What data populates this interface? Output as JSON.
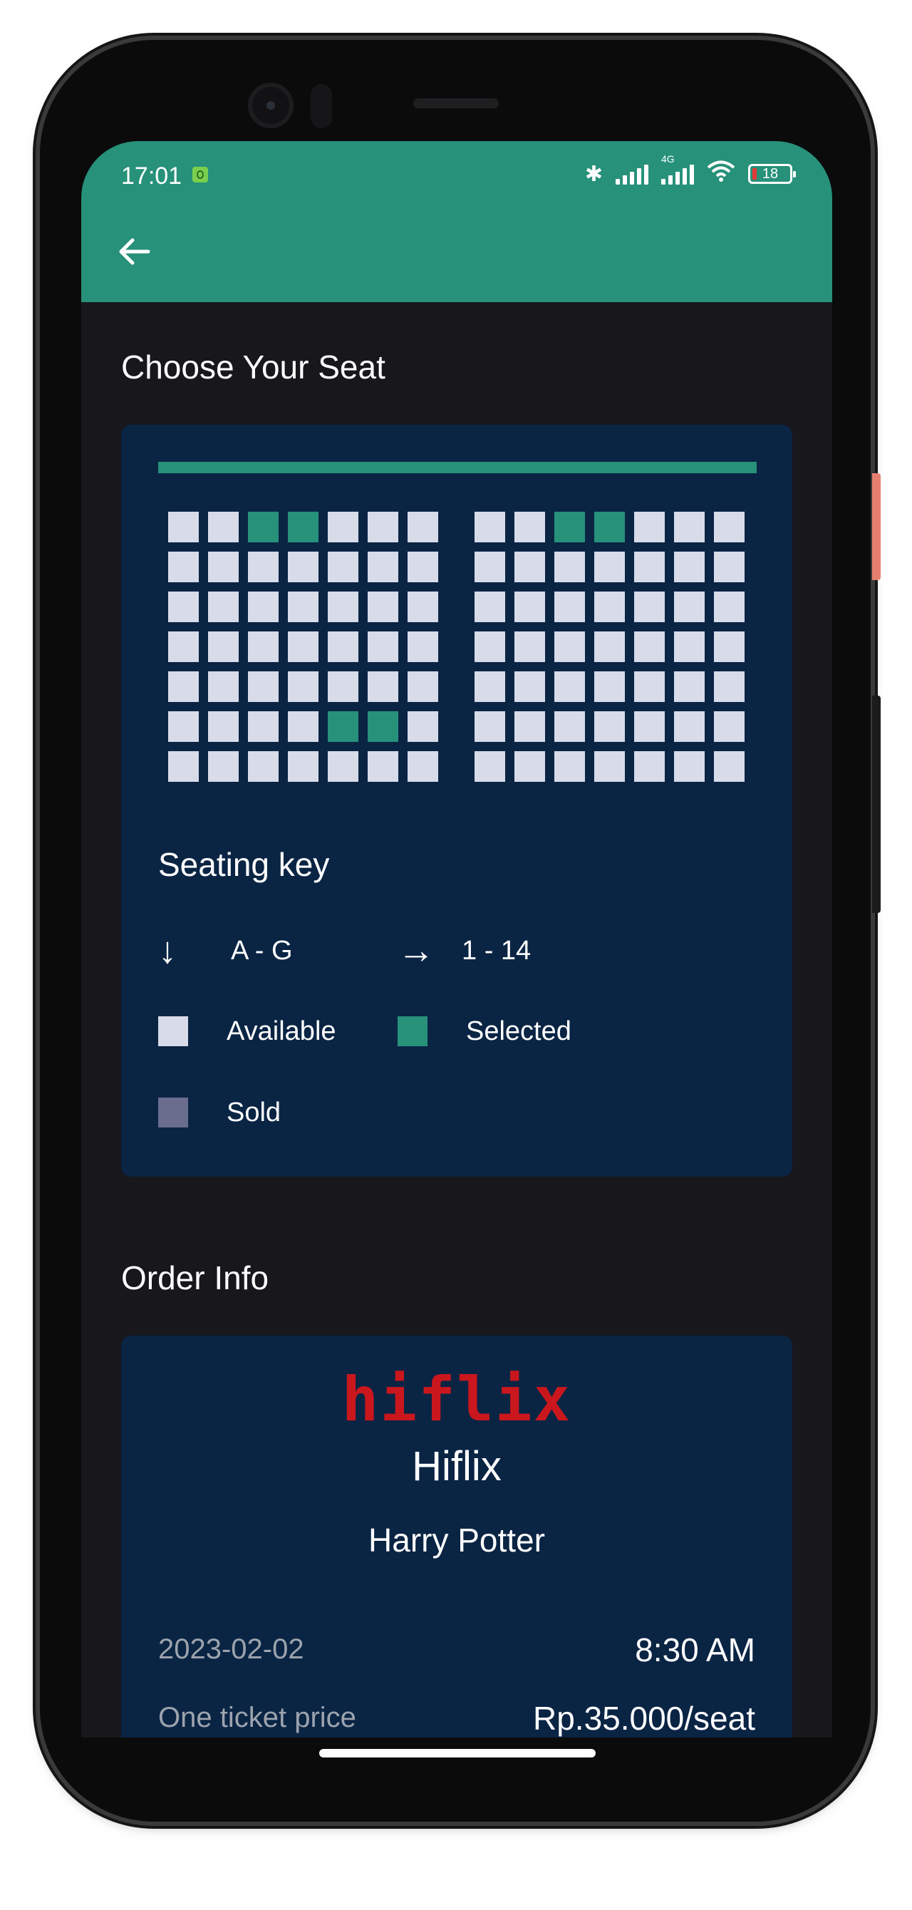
{
  "status_bar": {
    "time": "17:01",
    "network": "4G",
    "battery": "18"
  },
  "appbar": {
    "back_icon": "arrow-left-icon"
  },
  "seat_section": {
    "title": "Choose Your Seat"
  },
  "seat_map": {
    "rows": [
      "A",
      "B",
      "C",
      "D",
      "E",
      "F",
      "G"
    ],
    "columns_per_block": 7,
    "left_block": [
      [
        "available",
        "available",
        "selected",
        "selected",
        "available",
        "available",
        "available"
      ],
      [
        "available",
        "available",
        "available",
        "available",
        "available",
        "available",
        "available"
      ],
      [
        "available",
        "available",
        "available",
        "available",
        "available",
        "available",
        "available"
      ],
      [
        "available",
        "available",
        "available",
        "available",
        "available",
        "available",
        "available"
      ],
      [
        "available",
        "available",
        "available",
        "available",
        "available",
        "available",
        "available"
      ],
      [
        "available",
        "available",
        "available",
        "available",
        "selected",
        "selected",
        "available"
      ],
      [
        "available",
        "available",
        "available",
        "available",
        "available",
        "available",
        "available"
      ]
    ],
    "right_block": [
      [
        "available",
        "available",
        "selected",
        "selected",
        "available",
        "available",
        "available"
      ],
      [
        "available",
        "available",
        "available",
        "available",
        "available",
        "available",
        "available"
      ],
      [
        "available",
        "available",
        "available",
        "available",
        "available",
        "available",
        "available"
      ],
      [
        "available",
        "available",
        "available",
        "available",
        "available",
        "available",
        "available"
      ],
      [
        "available",
        "available",
        "available",
        "available",
        "available",
        "available",
        "available"
      ],
      [
        "available",
        "available",
        "available",
        "available",
        "available",
        "available",
        "available"
      ],
      [
        "available",
        "available",
        "available",
        "available",
        "available",
        "available",
        "available"
      ]
    ],
    "colors": {
      "available": "#d8dbe8",
      "selected": "#27917a",
      "sold": "#6b6d8e",
      "screen": "#27917a"
    }
  },
  "seating_key": {
    "title": "Seating key",
    "rows_label": "A - G",
    "columns_label": "1 - 14",
    "available": "Available",
    "selected": "Selected",
    "sold": "Sold"
  },
  "order_section": {
    "title": "Order Info"
  },
  "order_info": {
    "logo_text": "hiflix",
    "cinema": "Hiflix",
    "movie": "Harry Potter",
    "date": "2023-02-02",
    "time": "8:30 AM",
    "price_label": "One ticket price",
    "price_value": "Rp.35.000/seat"
  },
  "theme": {
    "primary": "#27917a",
    "card_bg": "#0a2444",
    "page_bg": "#17171c",
    "logo_red": "#c9171d"
  }
}
